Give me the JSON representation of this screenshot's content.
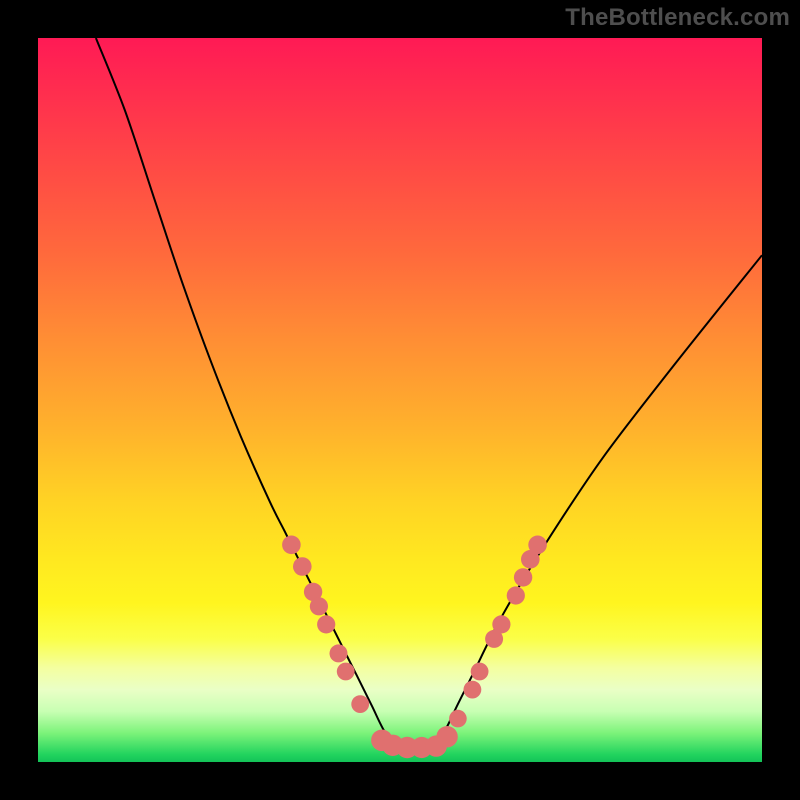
{
  "watermark": "TheBottleneck.com",
  "chart_data": {
    "type": "line",
    "title": "",
    "xlabel": "",
    "ylabel": "",
    "xlim": [
      0,
      100
    ],
    "ylim": [
      0,
      100
    ],
    "grid": false,
    "legend": false,
    "series": [
      {
        "name": "curve",
        "x": [
          8,
          12,
          16,
          20,
          24,
          28,
          32,
          34,
          36,
          38,
          40,
          42,
          44,
          46,
          48,
          50,
          52,
          54,
          56,
          58,
          60,
          64,
          70,
          78,
          88,
          100
        ],
        "y": [
          100,
          90,
          78,
          66,
          55,
          45,
          36,
          32,
          28,
          24,
          20,
          16,
          12,
          8,
          4,
          2,
          2,
          2,
          4,
          8,
          12,
          20,
          30,
          42,
          55,
          70
        ],
        "stroke": "#000000",
        "stroke_width": 2
      }
    ],
    "flat_bottom": {
      "x_start": 48,
      "x_end": 56,
      "y": 2
    },
    "markers": {
      "color": "#e0706f",
      "radius_min": 7,
      "radius_max": 11,
      "points": [
        {
          "x": 35.0,
          "y": 30.0
        },
        {
          "x": 36.5,
          "y": 27.0
        },
        {
          "x": 38.0,
          "y": 23.5
        },
        {
          "x": 38.8,
          "y": 21.5
        },
        {
          "x": 39.8,
          "y": 19.0
        },
        {
          "x": 41.5,
          "y": 15.0
        },
        {
          "x": 42.5,
          "y": 12.5
        },
        {
          "x": 44.5,
          "y": 8.0
        },
        {
          "x": 47.5,
          "y": 3.0
        },
        {
          "x": 49.0,
          "y": 2.3
        },
        {
          "x": 51.0,
          "y": 2.0
        },
        {
          "x": 53.0,
          "y": 2.0
        },
        {
          "x": 55.0,
          "y": 2.2
        },
        {
          "x": 56.5,
          "y": 3.5
        },
        {
          "x": 58.0,
          "y": 6.0
        },
        {
          "x": 60.0,
          "y": 10.0
        },
        {
          "x": 61.0,
          "y": 12.5
        },
        {
          "x": 63.0,
          "y": 17.0
        },
        {
          "x": 64.0,
          "y": 19.0
        },
        {
          "x": 66.0,
          "y": 23.0
        },
        {
          "x": 67.0,
          "y": 25.5
        },
        {
          "x": 68.0,
          "y": 28.0
        },
        {
          "x": 69.0,
          "y": 30.0
        }
      ]
    },
    "colors": {
      "gradient_top": "#ff1a55",
      "gradient_bottom": "#13c358",
      "background": "#000000",
      "watermark": "#4e4e4e"
    }
  }
}
